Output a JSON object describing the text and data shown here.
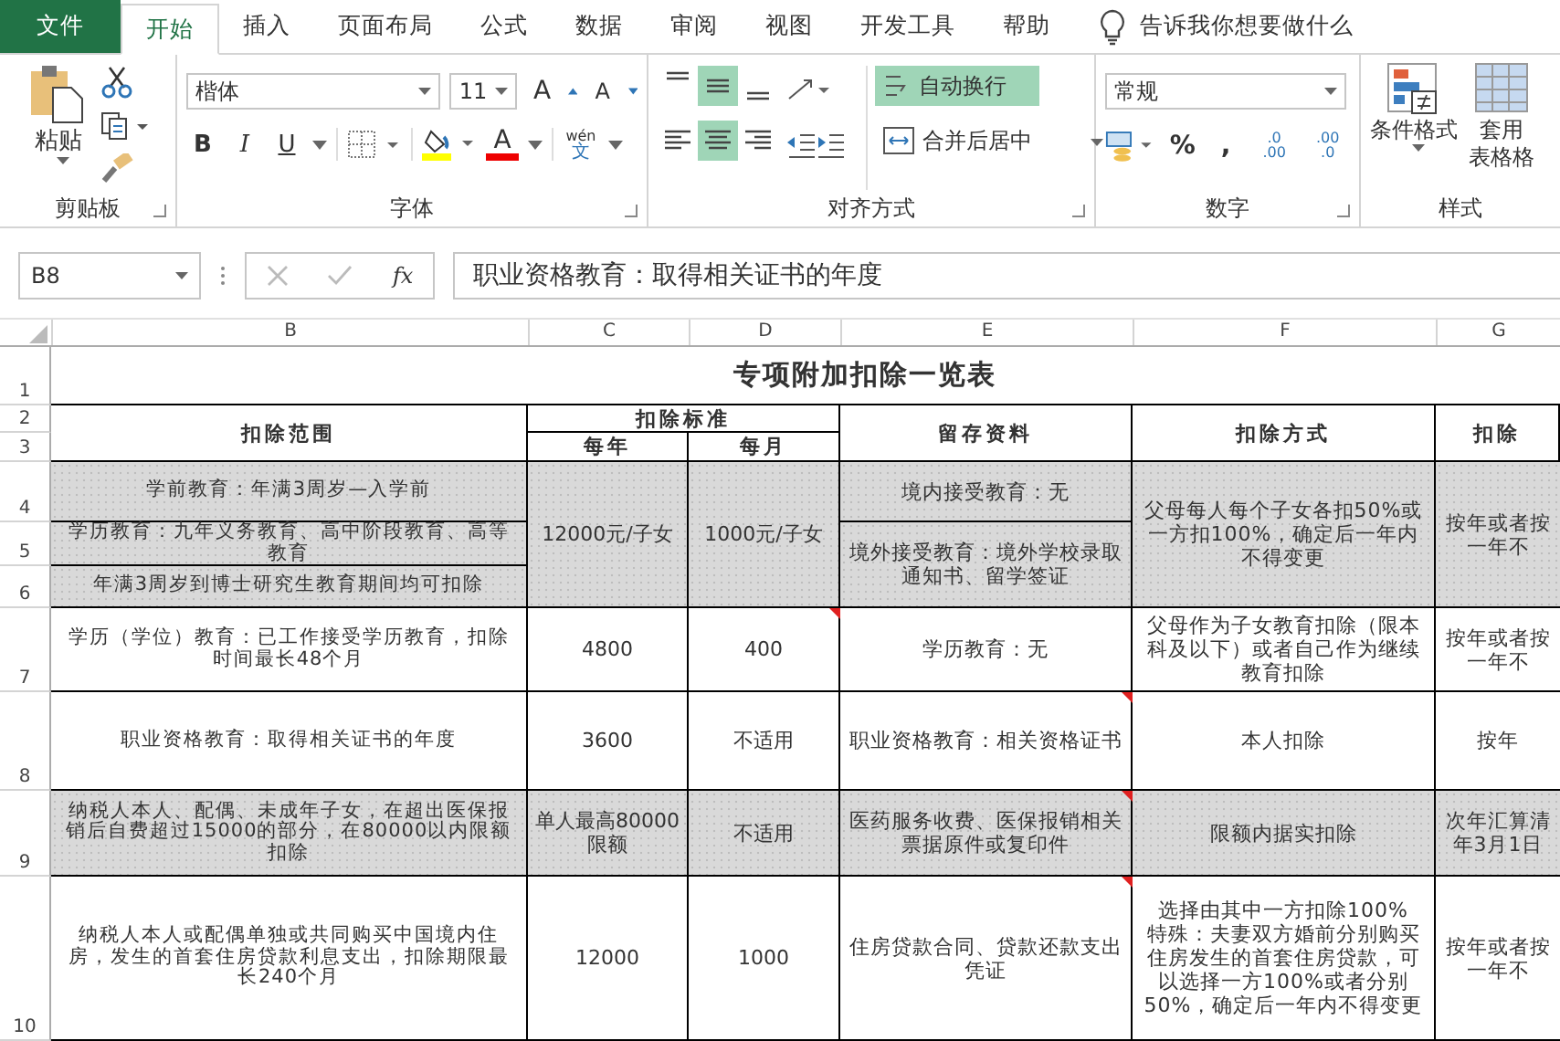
{
  "tabs": [
    {
      "label": "文件",
      "kind": "file",
      "selected": false
    },
    {
      "label": "开始",
      "kind": "tab",
      "selected": true
    },
    {
      "label": "插入",
      "kind": "tab",
      "selected": false
    },
    {
      "label": "页面布局",
      "kind": "tab",
      "selected": false
    },
    {
      "label": "公式",
      "kind": "tab",
      "selected": false
    },
    {
      "label": "数据",
      "kind": "tab",
      "selected": false
    },
    {
      "label": "审阅",
      "kind": "tab",
      "selected": false
    },
    {
      "label": "视图",
      "kind": "tab",
      "selected": false
    },
    {
      "label": "开发工具",
      "kind": "tab",
      "selected": false
    },
    {
      "label": "帮助",
      "kind": "tab",
      "selected": false
    }
  ],
  "tell_me": "告诉我你想要做什么",
  "clipboard": {
    "paste": "粘贴",
    "label": "剪贴板"
  },
  "font": {
    "name": "楷体",
    "size": "11",
    "grow": "A",
    "shrink": "A",
    "bold": "B",
    "italic": "I",
    "underline": "U",
    "font_color": "A",
    "phonetic_top": "wén",
    "phonetic_bottom": "文",
    "label": "字体"
  },
  "alignment": {
    "buttons": [
      {
        "kind": "top",
        "selected": false
      },
      {
        "kind": "middle",
        "selected": true
      },
      {
        "kind": "bottom",
        "selected": false
      },
      {
        "kind": "left",
        "selected": false
      },
      {
        "kind": "center",
        "selected": true
      },
      {
        "kind": "right",
        "selected": false
      }
    ],
    "wrap": {
      "label": "自动换行",
      "selected": true
    },
    "merge": {
      "label": "合并后居中",
      "selected": false
    },
    "label": "对齐方式"
  },
  "number": {
    "format": "常规",
    "percent": "%",
    "comma": ",",
    "increase_decimal": [
      ".0",
      ".00"
    ],
    "decrease_decimal": [
      ".00",
      ".0"
    ],
    "label": "数字"
  },
  "styles": {
    "conditional": "条件格式",
    "table_format": [
      "套用",
      "表格格"
    ],
    "label": "样式"
  },
  "formula_bar": {
    "name_box": "B8",
    "fx": "fx",
    "value": "职业资格教育：取得相关证书的年度"
  },
  "columns": [
    "B",
    "C",
    "D",
    "E",
    "F",
    "G"
  ],
  "sheet": {
    "title": "专项附加扣除一览表",
    "row_numbers": [
      "1",
      "2",
      "3",
      "4",
      "5",
      "6",
      "7",
      "8",
      "9",
      "10"
    ],
    "header": {
      "range": "扣除范围",
      "standard": "扣除标准",
      "per_year": "每年",
      "per_month": "每月",
      "documents": "留存资料",
      "method": "扣除方式",
      "column_g": "扣除"
    },
    "groups": [
      {
        "shaded": true,
        "range": [
          "学前教育：年满3周岁—入学前",
          "学历教育：九年义务教育、高中阶段教育、高等教育",
          "年满3周岁到博士研究生教育期间均可扣除"
        ],
        "per_year": "12000元/子女",
        "per_month": {
          "text": "1000元/子女",
          "comment": false
        },
        "documents": [
          {
            "text": "境内接受教育：无",
            "comment": false
          },
          {
            "text": "境外接受教育：境外学校录取通知书、留学签证",
            "comment": false
          }
        ],
        "method": "父母每人每个子女各扣50%或一方扣100%，确定后一年内不得变更",
        "column_g": "按年或者按一年不"
      },
      {
        "shaded": false,
        "range": [
          "学历（学位）教育：已工作接受学历教育，扣除时间最长48个月"
        ],
        "per_year": "4800",
        "per_month": {
          "text": "400",
          "comment": true
        },
        "documents": [
          {
            "text": "学历教育：无",
            "comment": false
          }
        ],
        "method": "父母作为子女教育扣除（限本科及以下）或者自己作为继续教育扣除",
        "column_g": "按年或者按一年不"
      },
      {
        "shaded": false,
        "range": [
          "职业资格教育：取得相关证书的年度"
        ],
        "per_year": "3600",
        "per_month": {
          "text": "不适用",
          "comment": false
        },
        "documents": [
          {
            "text": "职业资格教育：相关资格证书",
            "comment": true
          }
        ],
        "method": "本人扣除",
        "column_g": "按年"
      },
      {
        "shaded": true,
        "range": [
          "纳税人本人、配偶、未成年子女，在超出医保报销后自费超过15000的部分，在80000以内限额扣除"
        ],
        "per_year": "单人最高80000限额",
        "per_month": {
          "text": "不适用",
          "comment": false
        },
        "documents": [
          {
            "text": "医药服务收费、医保报销相关票据原件或复印件",
            "comment": true
          }
        ],
        "method": "限额内据实扣除",
        "column_g": "次年汇算清年3月1日"
      },
      {
        "shaded": false,
        "range": [
          "纳税人本人或配偶单独或共同购买中国境内住房，发生的首套住房贷款利息支出，扣除期限最长240个月"
        ],
        "per_year": "12000",
        "per_month": {
          "text": "1000",
          "comment": false
        },
        "documents": [
          {
            "text": "住房贷款合同、贷款还款支出凭证",
            "comment": true
          }
        ],
        "method": "选择由其中一方扣除100%\n特殊：夫妻双方婚前分别购买住房发生的首套住房贷款，可以选择一方100%或者分别50%，确定后一年内不得变更",
        "column_g": "按年或者按一年不"
      }
    ]
  }
}
